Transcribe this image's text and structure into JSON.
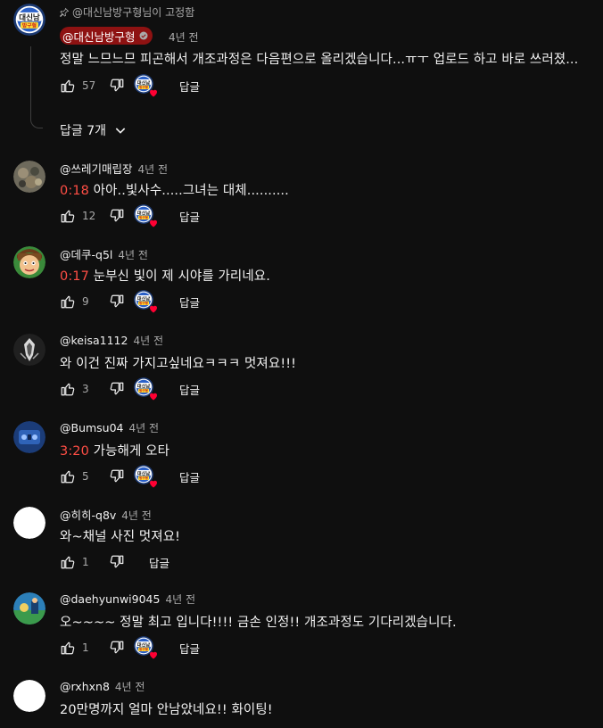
{
  "pinned": {
    "pin_text": "@대신남방구형님이 고정함",
    "author": "@대신남방구형",
    "time": "4년 전",
    "text": "정말 느므느므 피곤해서 개조과정은 다음편으로 올리겠습니다...ㅠㅜ 업로드 하고 바로 쓰러졌...",
    "likes": "57",
    "reply_label": "답글",
    "replies_toggle": "답글 7개"
  },
  "comments": [
    {
      "author": "@쓰레기매립장",
      "time": "4년 전",
      "stamp": "0:18",
      "text": " 아아..빛사수.....그녀는 대체..........",
      "likes": "12",
      "reply_label": "답글",
      "heart": true,
      "avatar": "rubble"
    },
    {
      "author": "@데쿠-q5l",
      "time": "4년 전",
      "stamp": "0:17",
      "text": " 눈부신 빛이 제 시야를 가리네요.",
      "likes": "9",
      "reply_label": "답글",
      "heart": true,
      "avatar": "cartoon"
    },
    {
      "author": "@keisa1112",
      "time": "4년 전",
      "stamp": "",
      "text": "와 이건 진짜 가지고싶네요ㅋㅋㅋ 멋져요!!!",
      "likes": "3",
      "reply_label": "답글",
      "heart": true,
      "avatar": "assassin"
    },
    {
      "author": "@Bumsu04",
      "time": "4년 전",
      "stamp": "3:20",
      "text": " 가능해게 오타",
      "likes": "5",
      "reply_label": "답글",
      "heart": true,
      "avatar": "blue"
    },
    {
      "author": "@히히-q8v",
      "time": "4년 전",
      "stamp": "",
      "text": "와~채널 사진 멋져요!",
      "likes": "1",
      "reply_label": "답글",
      "heart": false,
      "avatar": "white"
    },
    {
      "author": "@daehyunwi9045",
      "time": "4년 전",
      "stamp": "",
      "text": "오~~~~ 정말 최고 입니다!!!! 금손 인정!! 개조과정도 기다리겠습니다.",
      "likes": "1",
      "reply_label": "답글",
      "heart": true,
      "avatar": "game"
    },
    {
      "author": "@rxhxn8",
      "time": "4년 전",
      "stamp": "",
      "text": "20만명까지 얼마 안남았네요!! 화이팅!",
      "likes": "",
      "reply_label": "",
      "heart": false,
      "avatar": "white"
    }
  ],
  "colors": {
    "background": "#0f0f0f",
    "timestamp_link": "#ff4e45",
    "owner_chip": "#8e1212",
    "secondary_text": "#aaaaaa"
  },
  "channel_logo_text": [
    "대신남",
    "방구형"
  ]
}
